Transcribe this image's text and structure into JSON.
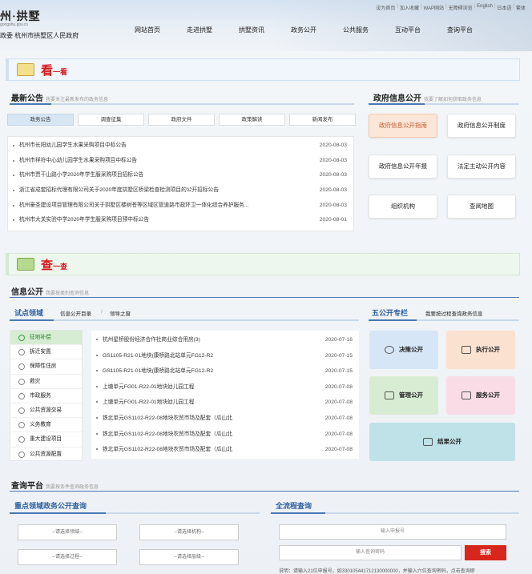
{
  "header": {
    "logo_main": "州·拱墅",
    "logo_url": "gongshu.gov.cn",
    "logo_sub": "政委 杭州市拱墅区人民政府",
    "top_links": [
      "设为首页",
      "加入收藏",
      "WAP网站",
      "无障碍浏览",
      "English",
      "日本语",
      "繁体"
    ],
    "nav": [
      "网站首页",
      "走进拱墅",
      "拱墅资讯",
      "政务公开",
      "公共服务",
      "互动平台",
      "查询平台"
    ]
  },
  "kan_banner": {
    "big": "看",
    "small": "一看"
  },
  "notice": {
    "title": "最新公告",
    "subtitle": "我要关注最新发布的政务信息",
    "tabs": [
      "政务公告",
      "调查征集",
      "政府文件",
      "政策解读",
      "新闻发布"
    ],
    "items": [
      {
        "text": "杭州市长阳幼儿园学生水果采购项目中标公告",
        "date": "2020-08-03"
      },
      {
        "text": "杭州市祥符中心幼儿园学生水果采购项目中标公告",
        "date": "2020-08-03"
      },
      {
        "text": "杭州市贾干山路小学2020年学生服采购项目招标公告",
        "date": "2020-08-03"
      },
      {
        "text": "浙江省成套招标代理有限公司关于2020年度拱墅区桥梁检查检测项目的公开招标公告",
        "date": "2020-08-03"
      },
      {
        "text": "杭州豪圣建设项目管理有限公司关于拱墅区楼树苍等区域区管道路市政环卫一体化综合养护服务...",
        "date": "2020-08-03"
      },
      {
        "text": "杭州市大关实验中学2020年学生服采购项目预中标公告",
        "date": "2020-08-01"
      }
    ]
  },
  "gov_info": {
    "title": "政府信息公开",
    "subtitle": "我要了解如何获取政务信息",
    "buttons": [
      "政府信息公开指南",
      "政府信息公开制度",
      "政府信息公开年报",
      "法定主动公开内容",
      "组织机构",
      "查阅地图"
    ]
  },
  "cha_banner": {
    "big": "查",
    "small": "一查"
  },
  "info_open": {
    "title": "信息公开",
    "subtitle": "我要按类别查询信息",
    "pilot_label": "试点领域",
    "catalog_link": "信息公开目录",
    "sep": "/",
    "leader_link": "领导之窗",
    "side_items": [
      "征地补偿",
      "拆迁安置",
      "保障性住房",
      "救灾",
      "市政服务",
      "公共资源交易",
      "义务教育",
      "重大建设项目",
      "公共资源配置"
    ],
    "items": [
      {
        "text": "杭州星桥股份经济合作社商业综合用房(3)",
        "date": "2020-07-16"
      },
      {
        "text": "GS1105-R21-01地块(康桥路北站单元FG12-R2",
        "date": "2020-07-15"
      },
      {
        "text": "GS1105-R21-01地块(康桥路北站单元FG12-R2",
        "date": "2020-07-15"
      },
      {
        "text": "上塘单元FG01-R22-01地块幼儿园工程",
        "date": "2020-07-08"
      },
      {
        "text": "上塘单元FG01-R22-01地块幼儿园工程",
        "date": "2020-07-08"
      },
      {
        "text": "铁北单元GS1102-R22-08地块农贸市场及配套（瓜山北",
        "date": "2020-07-08"
      },
      {
        "text": "铁北单元GS1102-R22-08地块农贸市场及配套（瓜山北",
        "date": "2020-07-08"
      },
      {
        "text": "铁北单元GS1102-R22-08地块农贸市场及配套（瓜山北",
        "date": "2020-07-08"
      }
    ]
  },
  "five_open": {
    "title": "五公开专栏",
    "subtitle": "我要按过程查询政务信息",
    "tiles": [
      "决策公开",
      "执行公开",
      "管理公开",
      "服务公开",
      "结果公开"
    ],
    "colors": [
      "#d7e6f6",
      "#fbe1cf",
      "#d8ecd3",
      "#f9dce6",
      "#bfe1e8"
    ]
  },
  "query": {
    "title": "查询平台",
    "subtitle": "我要按条件查询政务信息",
    "left_title": "重点领域政务公开查询",
    "selects": [
      "--请选择领域--",
      "--请选择机构--",
      "--请选择过程--",
      "--请选择层级--"
    ],
    "right_title": "全流程查询",
    "input1": "输入申报号",
    "input2": "输入查询密码",
    "search_btn": "搜索",
    "note": "说明：请输入21位申报号，如330105441712130000000，并输入六位查询密码，点击查询即"
  }
}
